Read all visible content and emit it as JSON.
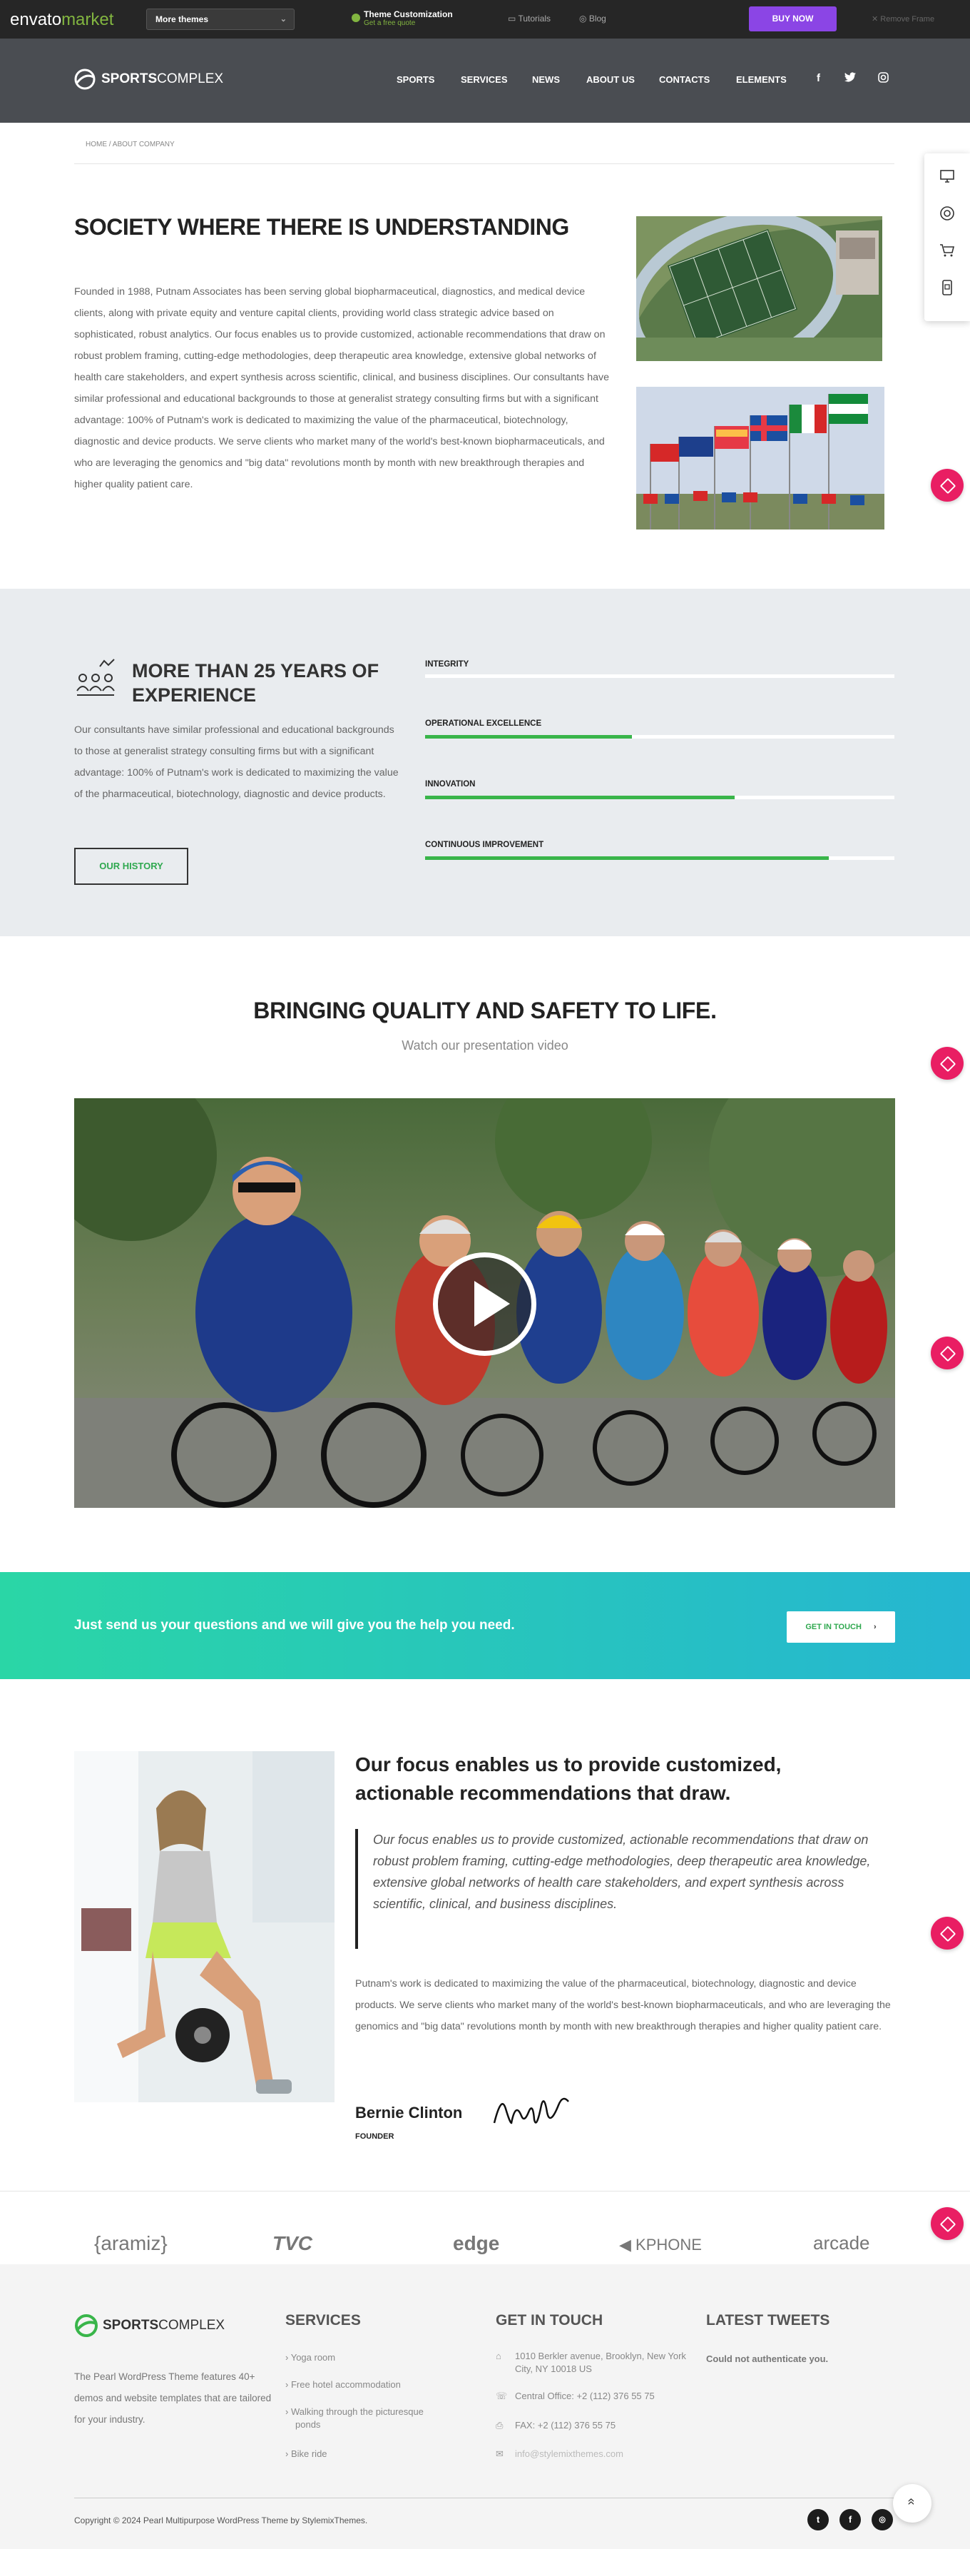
{
  "envato_bar": {
    "logo_main": "envato",
    "logo_accent": "market",
    "themes_dropdown": "More themes",
    "customization_title": "Theme Customization",
    "customization_sub": "Get a free quote",
    "tutorials": "Tutorials",
    "blog": "Blog",
    "buy_now": "BUY NOW",
    "remove_frame": "Remove Frame"
  },
  "header": {
    "brand_bold": "SPORTS",
    "brand_light": "COMPLEX",
    "nav": [
      "SPORTS",
      "SERVICES",
      "NEWS",
      "ABOUT US",
      "CONTACTS",
      "ELEMENTS"
    ],
    "social": [
      "f",
      "t",
      "ig"
    ]
  },
  "breadcrumb": "HOME / ABOUT COMPANY",
  "about": {
    "title": "SOCIETY WHERE THERE IS UNDERSTANDING",
    "text": "Founded in 1988, Putnam Associates has been serving global biopharmaceutical, diagnostics, and medical device clients, along with private equity and venture capital clients, providing world class strategic advice based on sophisticated, robust analytics. Our focus enables us to provide customized, actionable recommendations that draw on robust problem framing, cutting-edge methodologies, deep therapeutic area knowledge, extensive global networks of health care stakeholders, and expert synthesis across scientific, clinical, and business disciplines. Our consultants have similar professional and educational backgrounds to those at generalist strategy consulting firms but with a significant advantage: 100% of Putnam's work is dedicated to maximizing the value of the pharmaceutical, biotechnology, diagnostic and device products. We serve clients who market many of the world's best-known biopharmaceuticals, and who are leveraging the genomics and \"big data\" revolutions month by month with new breakthrough therapies and higher quality patient care."
  },
  "experience": {
    "title": "MORE THAN 25 YEARS OF EXPERIENCE",
    "text": "Our consultants have similar professional and educational backgrounds to those at generalist strategy consulting firms but with a significant advantage: 100% of Putnam's work is dedicated to maximizing the value of the pharmaceutical, biotechnology, diagnostic and device products.",
    "button": "OUR HISTORY",
    "skills": [
      {
        "label": "INTEGRITY",
        "value": 0
      },
      {
        "label": "OPERATIONAL EXCELLENCE",
        "value": 0.44
      },
      {
        "label": "INNOVATION",
        "value": 0.66
      },
      {
        "label": "CONTINUOUS IMPROVEMENT",
        "value": 0.86
      }
    ],
    "accent": "#39b54a"
  },
  "video": {
    "title": "BRINGING QUALITY AND SAFETY TO LIFE.",
    "subtitle": "Watch our presentation video"
  },
  "cta": {
    "text": "Just send us your questions and we will give you the help you need.",
    "button": "GET IN TOUCH"
  },
  "focus": {
    "title": "Our focus enables us to provide customized, actionable recommendations that draw.",
    "quote": "Our focus enables us to provide customized, actionable recommendations that draw on robust problem framing, cutting-edge methodologies, deep therapeutic area knowledge, extensive global networks of health care stakeholders, and expert synthesis across scientific, clinical, and business disciplines.",
    "text": "Putnam's work is dedicated to maximizing the value of the pharmaceutical, biotechnology, diagnostic and device products. We serve clients who market many of the world's best-known biopharmaceuticals, and who are leveraging the genomics and \"big data\" revolutions month by month with new breakthrough therapies and higher quality patient care.",
    "name": "Bernie Clinton",
    "role": "FOUNDER"
  },
  "client_logos": [
    "{aramiz}",
    "TVC",
    "edge",
    "KPHONE",
    "arcade"
  ],
  "footer": {
    "about_text": "The Pearl WordPress Theme features 40+ demos and website templates that are tailored for your industry.",
    "services_title": "SERVICES",
    "services": [
      "Yoga room",
      "Free hotel accommodation",
      "Walking through the picturesque ponds",
      "Bike ride"
    ],
    "contact_title": "GET IN TOUCH",
    "address": "1010 Berkler avenue, Brooklyn, New York City, NY 10018 US",
    "phone": "Central Office: +2 (112) 376 55 75",
    "fax": "FAX: +2 (112) 376 55 75",
    "email": "info@stylemixthemes.com",
    "tweets_title": "LATEST TWEETS",
    "tweets_msg": "Could not authenticate you.",
    "copyright": "Copyright © 2024 Pearl Multipurpose WordPress Theme by StylemixThemes."
  }
}
